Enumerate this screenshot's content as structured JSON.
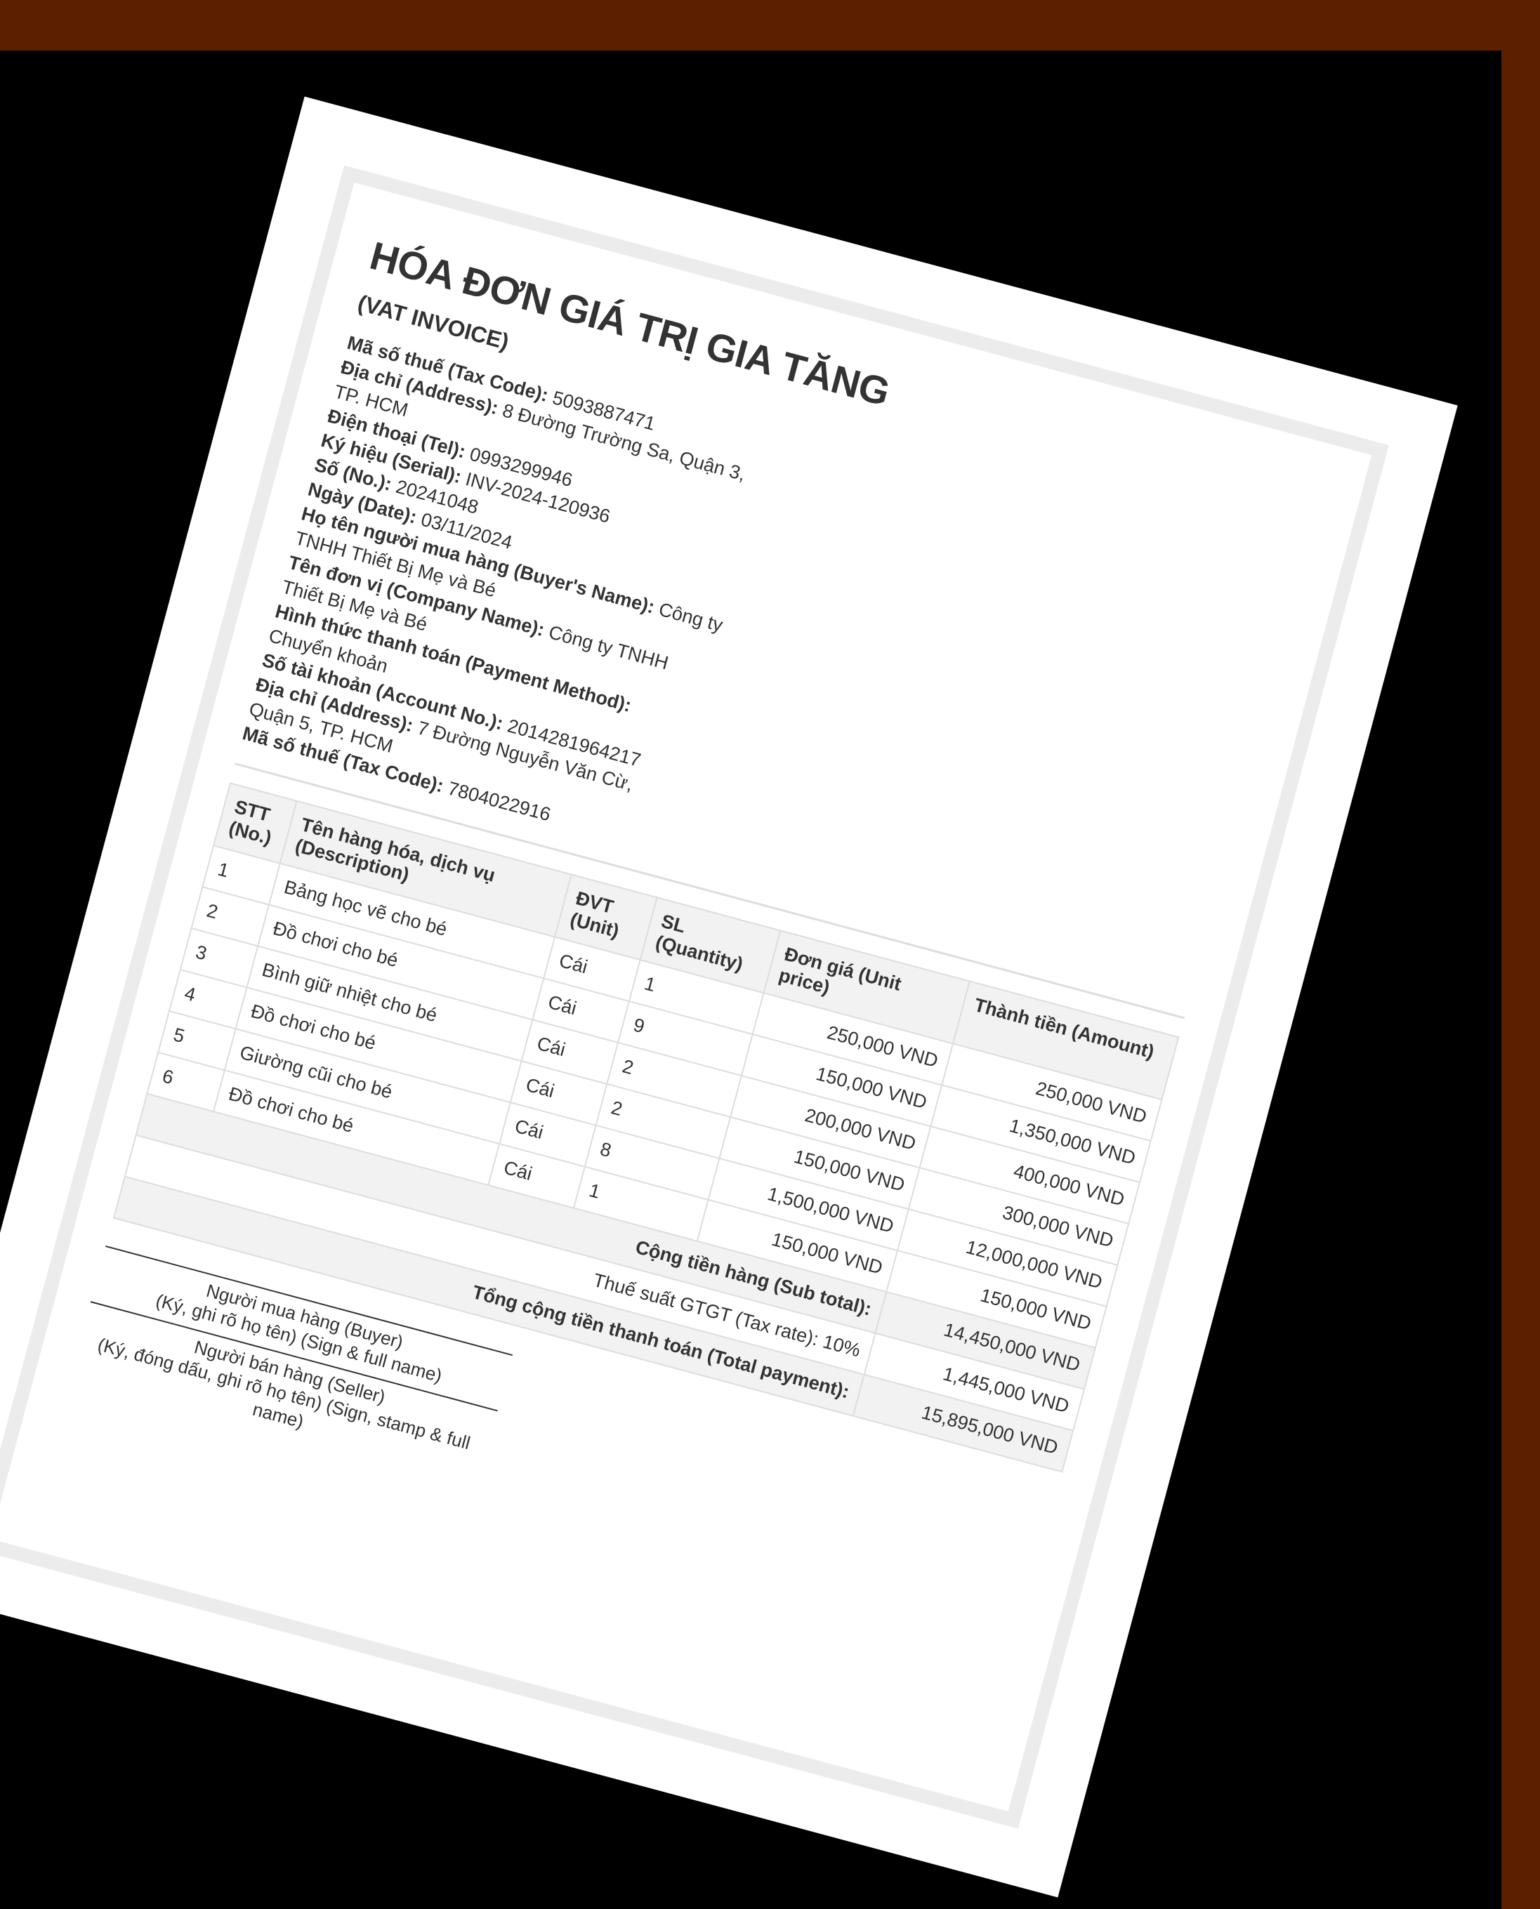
{
  "invoice": {
    "title": "HÓA ĐƠN GIÁ TRỊ GIA TĂNG",
    "subtitle": "(VAT INVOICE)",
    "seller": {
      "tax_code_label": "Mã số thuế (Tax Code):",
      "tax_code": "5093887471",
      "address_label": "Địa chỉ (Address):",
      "address": "8 Đường Trường Sa, Quận 3, TP. HCM",
      "phone_label": "Điện thoại (Tel):",
      "phone": "0993299946"
    },
    "serial_label": "Ký hiệu (Serial):",
    "serial": "INV-2024-120936",
    "number_label": "Số (No.):",
    "number": "20241048",
    "date_label": "Ngày (Date):",
    "date": "03/11/2024",
    "buyer": {
      "name_label": "Họ tên người mua hàng (Buyer's Name):",
      "name": "Công ty TNHH Thiết Bị Mẹ và Bé",
      "company_label": "Tên đơn vị (Company Name):",
      "company": "Công ty TNHH Thiết Bị Mẹ và Bé",
      "payment_label": "Hình thức thanh toán (Payment Method):",
      "payment": "Chuyển khoản",
      "account_label": "Số tài khoản (Account No.):",
      "account": "2014281964217",
      "address_label": "Địa chỉ (Address):",
      "address": "7 Đường Nguyễn Văn Cừ, Quận 5, TP. HCM",
      "tax_code_label": "Mã số thuế (Tax Code):",
      "tax_code": "7804022916"
    },
    "table": {
      "headers": {
        "no": "STT (No.)",
        "desc": "Tên hàng hóa, dịch vụ (Description)",
        "unit": "ĐVT (Unit)",
        "qty": "SL (Quantity)",
        "price": "Đơn giá (Unit price)",
        "amount": "Thành tiền (Amount)"
      },
      "rows": [
        {
          "no": "1",
          "desc": "Bảng học vẽ cho bé",
          "unit": "Cái",
          "qty": "1",
          "price": "250,000 VND",
          "amount": "250,000 VND"
        },
        {
          "no": "2",
          "desc": "Đồ chơi cho bé",
          "unit": "Cái",
          "qty": "9",
          "price": "150,000 VND",
          "amount": "1,350,000 VND"
        },
        {
          "no": "3",
          "desc": "Bình giữ nhiệt cho bé",
          "unit": "Cái",
          "qty": "2",
          "price": "200,000 VND",
          "amount": "400,000 VND"
        },
        {
          "no": "4",
          "desc": "Đồ chơi cho bé",
          "unit": "Cái",
          "qty": "2",
          "price": "150,000 VND",
          "amount": "300,000 VND"
        },
        {
          "no": "5",
          "desc": "Giường cũi cho bé",
          "unit": "Cái",
          "qty": "8",
          "price": "1,500,000 VND",
          "amount": "12,000,000 VND"
        },
        {
          "no": "6",
          "desc": "Đồ chơi cho bé",
          "unit": "Cái",
          "qty": "1",
          "price": "150,000 VND",
          "amount": "150,000 VND"
        }
      ],
      "subtotal_label": "Cộng tiền hàng (Sub total):",
      "subtotal": "14,450,000 VND",
      "tax_label": "Thuế suất GTGT (Tax rate): 10%",
      "tax": "1,445,000 VND",
      "total_label": "Tổng cộng tiền thanh toán (Total payment):",
      "total": "15,895,000 VND"
    },
    "signatures": {
      "buyer_title": "Người mua hàng (Buyer)",
      "buyer_note": "(Ký, ghi rõ họ tên) (Sign & full name)",
      "seller_title": "Người bán hàng (Seller)",
      "seller_note": "(Ký, đóng dấu, ghi rõ họ tên) (Sign, stamp & full name)"
    }
  }
}
